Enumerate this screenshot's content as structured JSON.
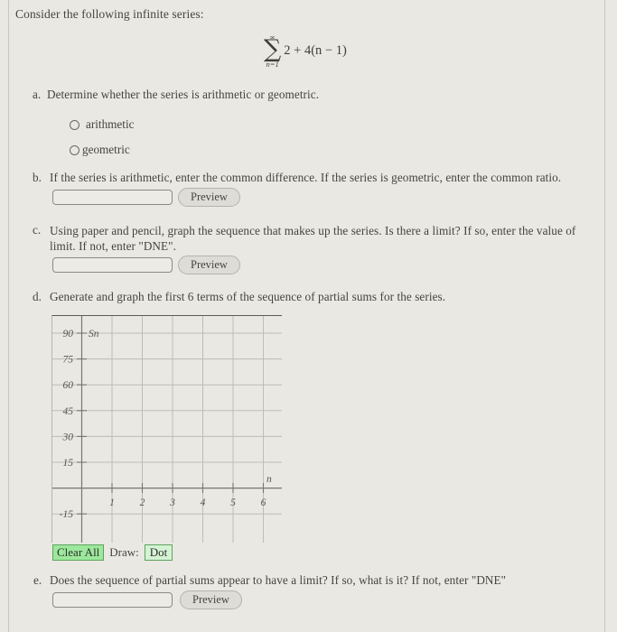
{
  "intro": "Consider the following infinite series:",
  "formula": {
    "upper_limit": "∞",
    "sigma": "∑",
    "lower_limit": "n=1",
    "expression": "2 + 4(n − 1)"
  },
  "questions": [
    {
      "letter": "a.",
      "text": "Determine whether the series is arithmetic or geometric.",
      "options": [
        "arithmetic",
        "geometric"
      ]
    },
    {
      "letter": "b.",
      "text": "If the series is arithmetic, enter the common difference. If the series is geometric, enter the common ratio.",
      "input_value": "",
      "input_placeholder": "",
      "preview_label": "Preview"
    },
    {
      "letter": "c.",
      "text": "Using paper and pencil, graph the sequence that makes up the series. Is there a limit? If so, enter the value of limit. If not, enter \"DNE\".",
      "input_value": "",
      "input_placeholder": "",
      "preview_label": "Preview"
    },
    {
      "letter": "d.",
      "text": "Generate and graph the first 6 terms of the sequence of partial sums for the series."
    },
    {
      "letter": "e.",
      "text": "Does the sequence of partial sums appear to have a limit? If so, what is it? If not, enter \"DNE\"",
      "input_value": "",
      "input_placeholder": "",
      "preview_label": "Preview"
    }
  ],
  "graph": {
    "x_axis_label": "n",
    "y_axis_label": "Sn",
    "y_ticks": [
      "90",
      "75",
      "60",
      "45",
      "30",
      "15",
      "-15"
    ],
    "x_ticks": [
      "1",
      "2",
      "3",
      "4",
      "5",
      "6"
    ],
    "grid_color": "#bdbcb6",
    "axis_color": "#77776f"
  },
  "toolbar": {
    "clear_all_label": "Clear All",
    "draw_label": "Draw:",
    "dot_label": "Dot",
    "clear_all_color": "#9ce89c",
    "dot_color": "#d4f3d4"
  }
}
